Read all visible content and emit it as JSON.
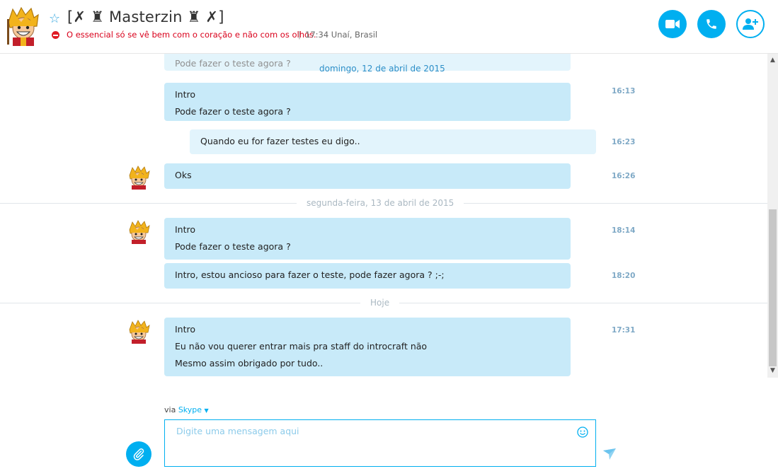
{
  "header": {
    "contact_name": "[✗ ♜ Masterzin ♜ ✗]",
    "mood": "O essencial só se vê bem com o coração e não com os olhos.",
    "separator": "|",
    "local_time": "17:34 Unaí, Brasil",
    "buttons": [
      "video-call-icon",
      "voice-call-icon",
      "add-contact-icon"
    ]
  },
  "conversation": {
    "ghost_message": "Pode fazer o teste agora ?",
    "day1": "domingo, 12 de abril de 2015",
    "msg1": {
      "line1": "Intro",
      "line2": "Pode fazer o teste agora ?",
      "time": "16:13"
    },
    "msg2": {
      "text": "Quando eu for fazer testes eu digo..",
      "time": "16:23"
    },
    "msg3": {
      "text": "Oks",
      "time": "16:26"
    },
    "day2": "segunda-feira, 13 de abril de 2015",
    "msg4": {
      "line1": "Intro",
      "line2": "Pode fazer o teste agora ?",
      "time": "18:14"
    },
    "msg5": {
      "text": "Intro, estou ancioso para fazer o teste, pode fazer agora ? ;-;",
      "time": "18:20"
    },
    "day3": "Hoje",
    "msg6": {
      "line1": "Intro",
      "line2": "Eu não vou querer entrar mais pra staff do introcraft não",
      "line3": "Mesmo assim obrigado por tudo..",
      "time": "17:31"
    }
  },
  "compose": {
    "via_label": "via",
    "via_service": "Skype",
    "placeholder": "Digite uma mensagem aqui"
  },
  "colors": {
    "accent": "#00aff0",
    "bubble_in": "#c8eaf9",
    "bubble_out": "#e2f4fc",
    "mood_red": "#d9001b"
  }
}
